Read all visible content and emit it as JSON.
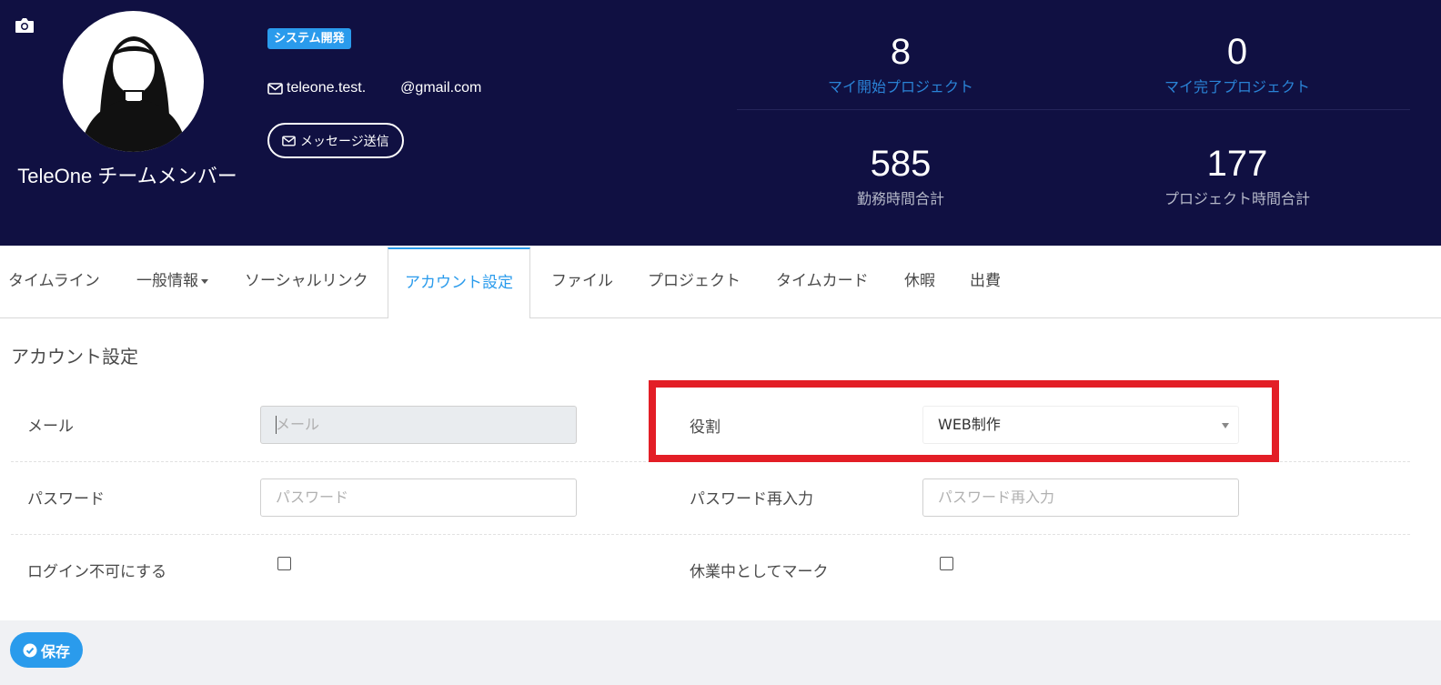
{
  "profile": {
    "name": "TeleOne チームメンバー",
    "department": "システム開発",
    "email_user": "teleone.test.",
    "email_domain": "@gmail.com",
    "message_button": "メッセージ送信"
  },
  "stats": [
    {
      "value": "8",
      "label": "マイ開始プロジェクト"
    },
    {
      "value": "0",
      "label": "マイ完了プロジェクト"
    },
    {
      "value": "585",
      "label": "勤務時間合計"
    },
    {
      "value": "177",
      "label": "プロジェクト時間合計"
    }
  ],
  "tabs": [
    {
      "label": "タイムライン"
    },
    {
      "label": "一般情報"
    },
    {
      "label": "ソーシャルリンク"
    },
    {
      "label": "アカウント設定"
    },
    {
      "label": "ファイル"
    },
    {
      "label": "プロジェクト"
    },
    {
      "label": "タイムカード"
    },
    {
      "label": "休暇"
    },
    {
      "label": "出費"
    }
  ],
  "account": {
    "title": "アカウント設定",
    "email_label": "メール",
    "email_placeholder": "メール",
    "role_label": "役割",
    "role_value": "WEB制作",
    "password_label": "パスワード",
    "password_placeholder": "パスワード",
    "password_confirm_label": "パスワード再入力",
    "password_confirm_placeholder": "パスワード再入力",
    "disable_login_label": "ログイン不可にする",
    "mark_inactive_label": "休業中としてマーク"
  },
  "save_label": "保存",
  "colors": {
    "header_bg": "#101042",
    "accent": "#2a9bec",
    "highlight": "#e31e26"
  }
}
